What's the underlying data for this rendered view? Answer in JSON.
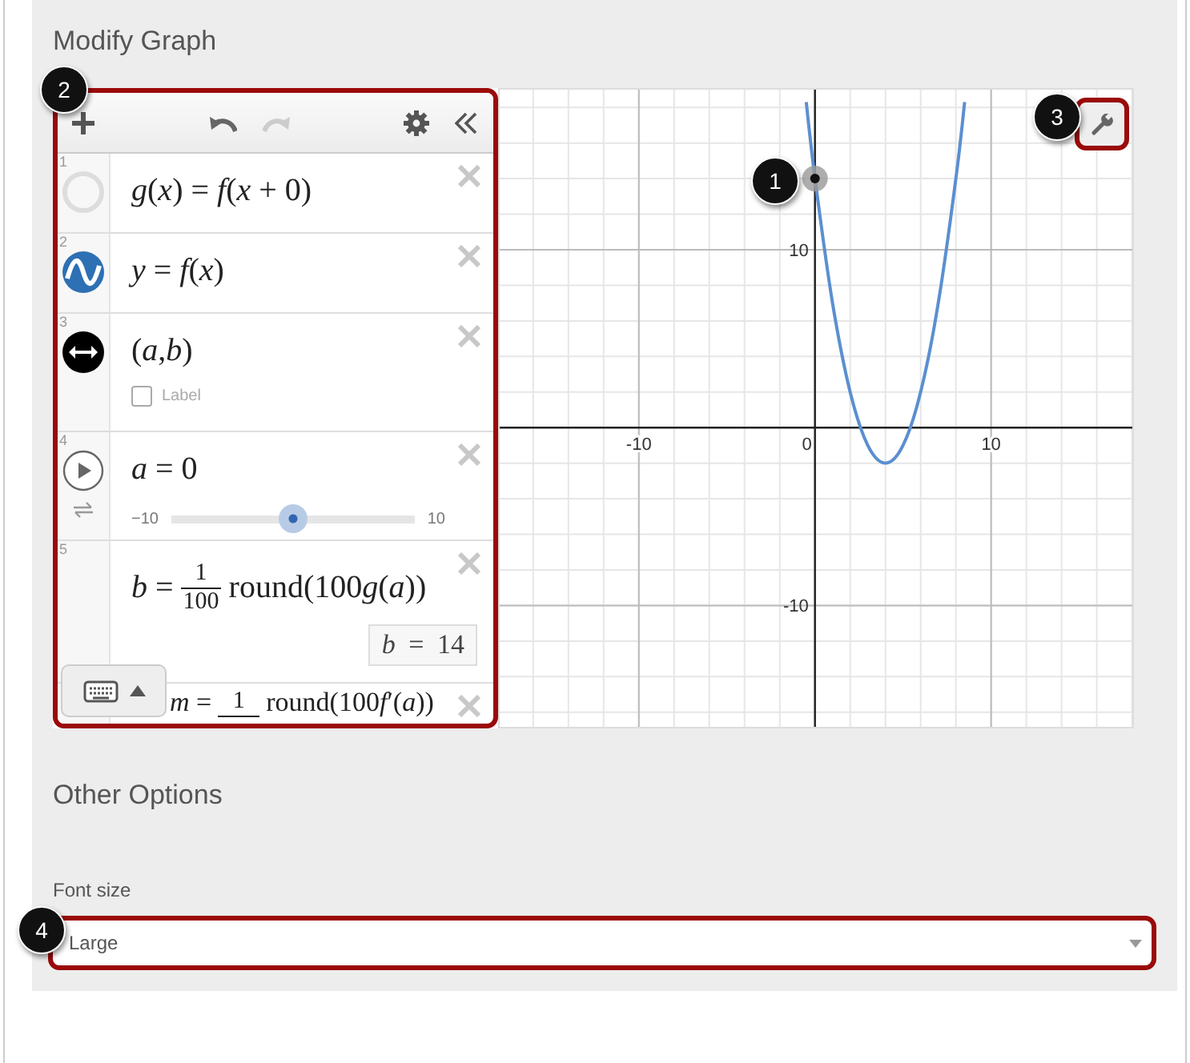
{
  "section_title": "Modify Graph",
  "expression_list": {
    "toolbar": {
      "undo_disabled": false,
      "redo_disabled": true
    },
    "expressions": [
      {
        "number": "1",
        "kind": "function",
        "visible": false,
        "latex": "*g*(*x*) = *f*(*x* + 0)"
      },
      {
        "number": "2",
        "kind": "function",
        "visible": true,
        "latex": "*y* = *f*(*x*)"
      },
      {
        "number": "3",
        "kind": "point",
        "latex": "(*a*,*b*)",
        "label_checkbox": {
          "label": "Label",
          "checked": false
        }
      },
      {
        "number": "4",
        "kind": "slider",
        "latex": "*a* = 0",
        "slider": {
          "min": "−10",
          "max": "10",
          "level": 0.5
        }
      },
      {
        "number": "5",
        "kind": "fraction",
        "lhs": "*b* =",
        "numerator": "1",
        "denominator": "100",
        "rhs": [
          "round(100",
          "*g*(*a*))"
        ],
        "result": "*b* = 14"
      },
      {
        "kind": "fraction",
        "lhs": "*m* =",
        "numerator": "1",
        "rhs": [
          "round(100",
          "*f*′(*a*))"
        ]
      }
    ]
  },
  "graph": {
    "chart_data": {
      "type": "line",
      "xlim": [
        -17.9,
        18.2
      ],
      "ylim": [
        -17,
        19
      ],
      "xticks": [
        {
          "value": -10,
          "label": "-10"
        },
        {
          "value": 0,
          "label": "0"
        },
        {
          "value": 10,
          "label": "10"
        }
      ],
      "yticks": [
        {
          "value": -10,
          "label": "-10"
        },
        {
          "value": 10,
          "label": "10"
        }
      ],
      "x": [
        -0.5,
        0,
        1,
        2,
        3,
        4,
        5,
        6,
        7,
        8,
        8.5
      ],
      "series": [
        {
          "color": "#5b8fd0",
          "values": [
            18.3,
            14,
            7,
            2,
            -1,
            -2,
            -1,
            2,
            7,
            14,
            18.3
          ]
        }
      ],
      "grid": true
    }
  },
  "callouts": [
    "1",
    "2",
    "3",
    "4"
  ],
  "other_options": {
    "title": "Other Options",
    "font_size": {
      "label": "Font size",
      "value": "Large"
    }
  }
}
